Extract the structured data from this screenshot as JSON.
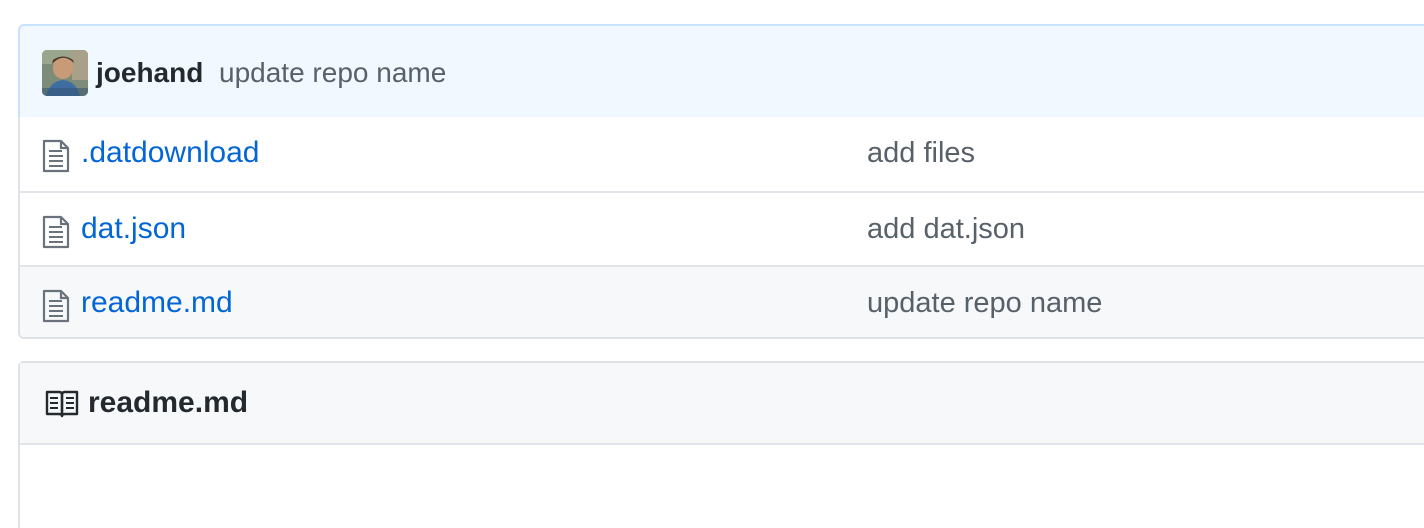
{
  "latest_commit": {
    "author": "joehand",
    "message": "update repo name"
  },
  "files": [
    {
      "name": ".datdownload",
      "commit_message": "add files",
      "icon": "file-icon"
    },
    {
      "name": "dat.json",
      "commit_message": "add dat.json",
      "icon": "file-icon"
    },
    {
      "name": "readme.md",
      "commit_message": "update repo name",
      "icon": "file-icon"
    }
  ],
  "readme": {
    "title": "readme.md",
    "icon": "book-icon"
  },
  "colors": {
    "link": "#0366d6",
    "muted": "#586069",
    "commit_bar_bg": "#f1f8ff",
    "commit_bar_border": "#c8e1ff"
  }
}
